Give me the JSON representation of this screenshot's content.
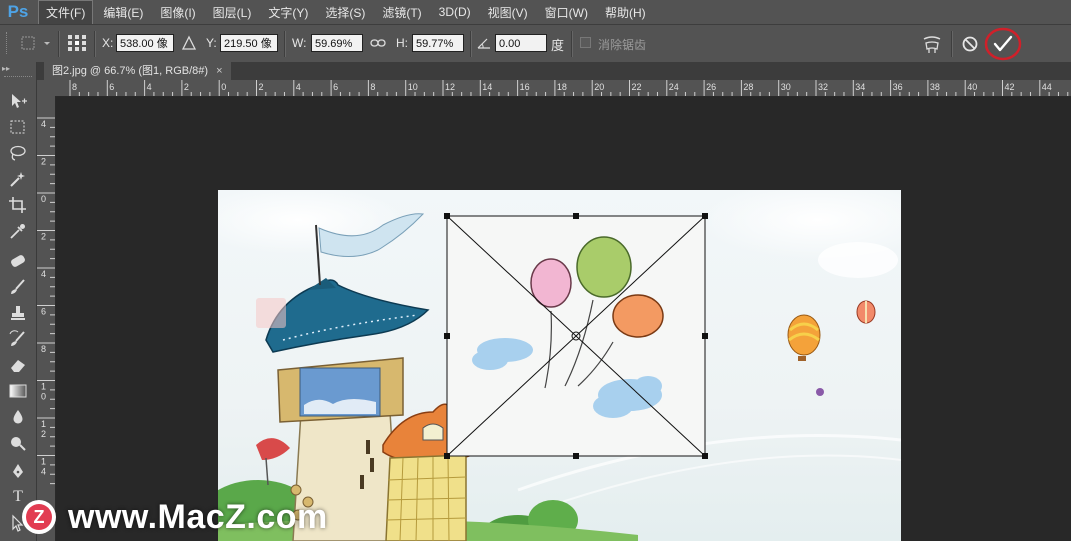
{
  "app": {
    "logo": "Ps",
    "accent": "#4ea3e6"
  },
  "menu": [
    "文件(F)",
    "编辑(E)",
    "图像(I)",
    "图层(L)",
    "文字(Y)",
    "选择(S)",
    "滤镜(T)",
    "3D(D)",
    "视图(V)",
    "窗口(W)",
    "帮助(H)"
  ],
  "options": {
    "x_label": "X:",
    "x_value": "538.00 像",
    "y_label": "Y:",
    "y_value": "219.50 像",
    "w_label": "W:",
    "w_value": "59.69%",
    "h_label": "H:",
    "h_value": "59.77%",
    "angle_value": "0.00",
    "angle_unit": "度",
    "antialias_label": "消除锯齿"
  },
  "document": {
    "tab_title": "图2.jpg @ 66.7% (图1, RGB/8#)",
    "close": "×"
  },
  "rulers": {
    "horizontal": [
      "8",
      "6",
      "4",
      "2",
      "0",
      "2",
      "4",
      "6",
      "8",
      "10",
      "12",
      "14",
      "16",
      "18",
      "20",
      "22",
      "24",
      "26",
      "28",
      "30",
      "32",
      "34",
      "36",
      "38",
      "40",
      "42",
      "44"
    ],
    "vertical": [
      "4",
      "2",
      "0",
      "2",
      "4",
      "6",
      "8",
      "10",
      "12",
      "14"
    ]
  },
  "icons": {
    "move": "move-tool-icon",
    "marquee": "marquee-tool-icon",
    "lasso": "lasso-tool-icon",
    "wand": "magic-wand-icon",
    "crop": "crop-tool-icon",
    "eyedropper": "eyedropper-icon",
    "heal": "healing-brush-icon",
    "brush": "brush-tool-icon",
    "stamp": "clone-stamp-icon",
    "history": "history-brush-icon",
    "eraser": "eraser-icon",
    "gradient": "gradient-tool-icon",
    "blur": "blur-tool-icon",
    "dodge": "dodge-tool-icon",
    "pen": "pen-tool-icon",
    "text": "T",
    "path": "path-select-icon"
  },
  "watermark": {
    "badge": "Z",
    "text": "www.MacZ.com"
  },
  "colors": {
    "commit_highlight": "#d0202a"
  }
}
